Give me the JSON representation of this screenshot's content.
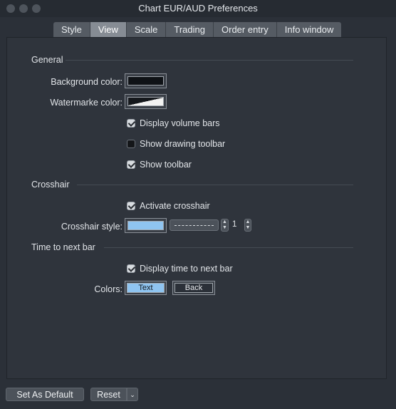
{
  "window": {
    "title": "Chart EUR/AUD Preferences"
  },
  "tabs": [
    {
      "label": "Style"
    },
    {
      "label": "View",
      "active": true
    },
    {
      "label": "Scale"
    },
    {
      "label": "Trading"
    },
    {
      "label": "Order entry"
    },
    {
      "label": "Info window"
    }
  ],
  "general": {
    "heading": "General",
    "background_color_label": "Background color:",
    "background_color": "#0f1216",
    "watermark_color_label": "Watermarke color:",
    "display_volume_bars": {
      "label": "Display volume bars",
      "checked": true
    },
    "show_drawing_toolbar": {
      "label": "Show drawing toolbar",
      "checked": false
    },
    "show_toolbar": {
      "label": "Show toolbar",
      "checked": true
    }
  },
  "crosshair": {
    "heading": "Crosshair",
    "activate": {
      "label": "Activate crosshair",
      "checked": true
    },
    "style_label": "Crosshair style:",
    "color": "#8fc4f0",
    "line_width": "1"
  },
  "time_to_next_bar": {
    "heading": "Time to next bar",
    "display": {
      "label": "Display time to next bar",
      "checked": true
    },
    "colors_label": "Colors:",
    "text_button": {
      "label": "Text",
      "color": "#8fc4f0"
    },
    "back_button": {
      "label": "Back",
      "color": "#2b3038"
    }
  },
  "footer": {
    "set_default_label": "Set As Default",
    "reset_label": "Reset"
  }
}
